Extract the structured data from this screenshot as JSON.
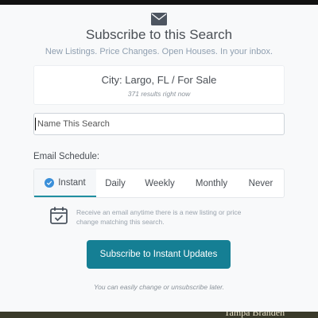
{
  "modal": {
    "title": "Subscribe to this Search",
    "subtitle": "New Listings. Price Changes. Open Houses. In your inbox.",
    "icon": "envelope-icon"
  },
  "search_card": {
    "name": "City: Largo, FL / For Sale",
    "count": "371 results right now"
  },
  "name_input": {
    "placeholder": "Name This Search",
    "value": ""
  },
  "schedule": {
    "label": "Email Schedule:",
    "tabs": [
      {
        "label": "Instant",
        "selected": true
      },
      {
        "label": "Daily",
        "selected": false
      },
      {
        "label": "Weekly",
        "selected": false
      },
      {
        "label": "Monthly",
        "selected": false
      },
      {
        "label": "Never",
        "selected": false
      }
    ]
  },
  "description": {
    "icon": "calendar-check-icon",
    "text": "Receive an email anytime there is a new listing or price change matching this search."
  },
  "primary_button": {
    "label": "Subscribe to Instant Updates"
  },
  "footnote": "You can easily change or unsubscribe later.",
  "background_text": "Tampa Branden",
  "colors": {
    "accent": "#157f94",
    "check": "#3a8fd9",
    "text": "#4a4f55",
    "muted": "#8f9fb0"
  }
}
